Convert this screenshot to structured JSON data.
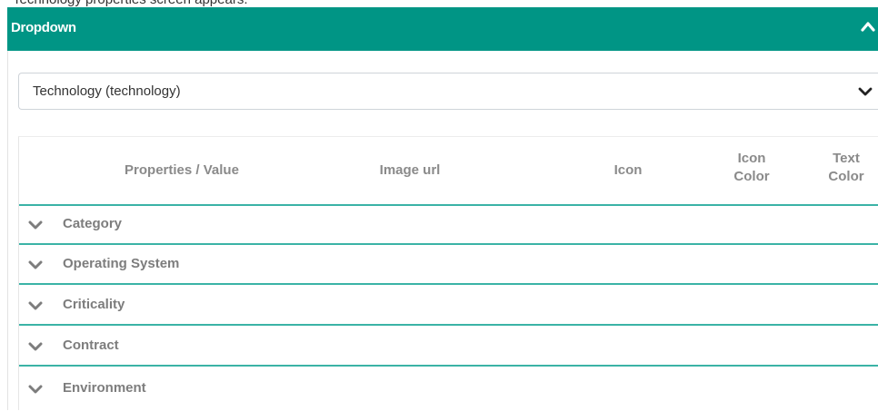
{
  "top_strip": {
    "text": "Technology properties screen appears."
  },
  "panel": {
    "title": "Dropdown",
    "collapse_icon": "chevron-up-icon"
  },
  "select": {
    "value": "Technology (technology)",
    "chevron_icon": "chevron-down-icon"
  },
  "table": {
    "headers": {
      "properties": "Properties / Value",
      "image_url": "Image url",
      "icon": "Icon",
      "icon_color_line1": "Icon",
      "icon_color_line2": "Color",
      "text_color_line1": "Text",
      "text_color_line2": "Color"
    },
    "rows": [
      {
        "label": "Category"
      },
      {
        "label": "Operating System"
      },
      {
        "label": "Criticality"
      },
      {
        "label": "Contract"
      },
      {
        "label": "Environment"
      }
    ]
  },
  "colors": {
    "header_bg": "#009585",
    "row_divider": "#3bb3a6",
    "muted_text": "#7d7d7d"
  }
}
